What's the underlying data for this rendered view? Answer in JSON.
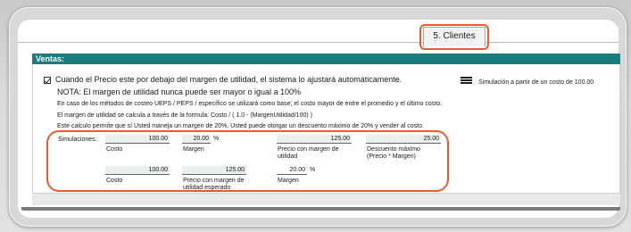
{
  "tab": {
    "label": "5. Clientes"
  },
  "section": {
    "title": "Ventas:"
  },
  "main": {
    "checkbox_label": "Cuando el Precio este por debajo del margen de utilidad, el sistema lo ajustará automáticamente.",
    "checked": true,
    "note": "NOTA: El margen de utilidad nunca puede ser mayor o igual a 100%",
    "info_1": "En caso de los métodos de costeo UEPS / PEPS / específico se utilizará como base, el costo mayor de entre el promedio y el último costo.",
    "info_2": "El margen de utilidad se calcula a través de la formula: Costo / ( 1.0 - (MargenUtilidad/100) )",
    "info_3": "Este calculo permite que sí Usted maneja un margen de 20%, Usted puede otorgar un descuento máximo de 20% y vender al costo."
  },
  "simulation": {
    "label": "Simulación a partir de un costo de 100.00",
    "icon": "list-icon"
  },
  "sims": {
    "title": "Simulaciones:",
    "row1": {
      "costo_value": "100.00",
      "costo_label": "Costo",
      "margen_value": "20.00",
      "margen_pct": "%",
      "margen_label": "Margen",
      "precio_value": "125.00",
      "precio_label": "Precio con margen de utilidad",
      "descuento_value": "25.00",
      "descuento_label": "Descuento máximo (Precio * Margen)"
    },
    "row2": {
      "costo_value": "100.00",
      "costo_label": "Costo",
      "precio_value": "125.00",
      "precio_label": "Precio con margen de utilidad esperado",
      "margen_value": "20.00",
      "margen_pct": "%",
      "margen_label": "Margen"
    }
  },
  "colors": {
    "header": "#1a7c7f",
    "highlight": "#ea5a2e"
  }
}
